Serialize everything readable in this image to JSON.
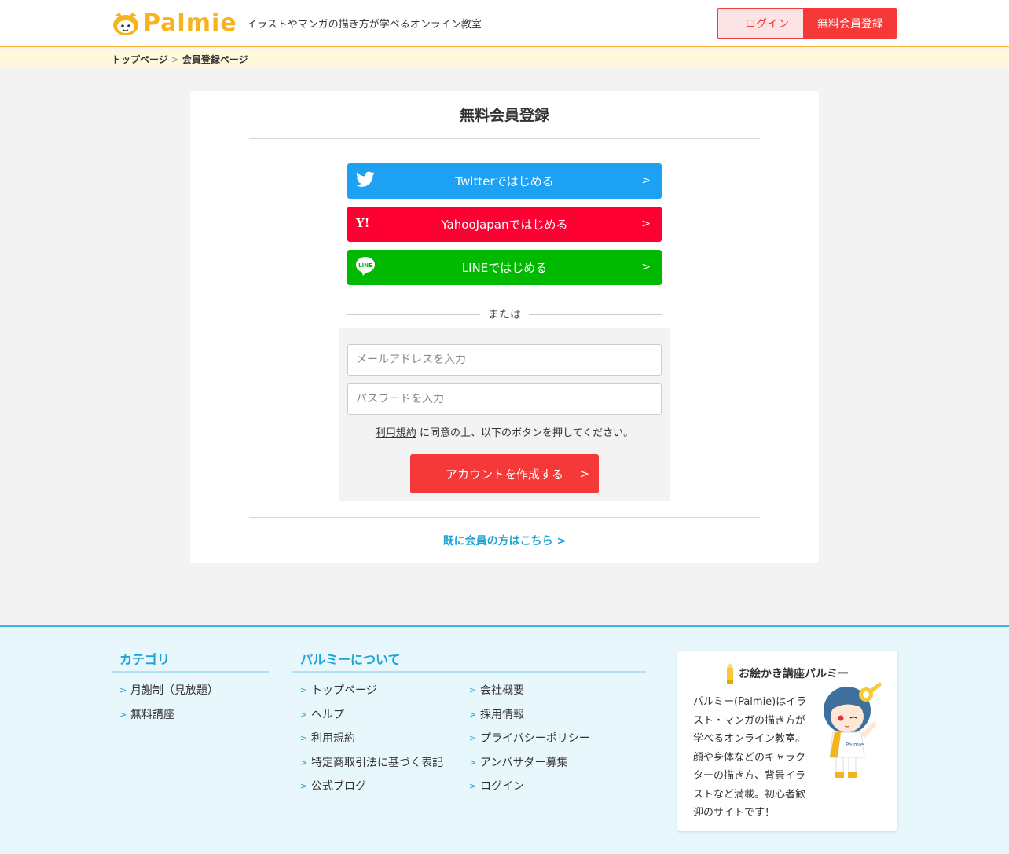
{
  "header": {
    "logo_text": "Palmie",
    "tagline": "イラストやマンガの描き方が学べるオンライン教室",
    "login_label": "ログイン",
    "signup_label": "無料会員登録"
  },
  "breadcrumb": {
    "items": [
      "トップページ",
      "会員登録ページ"
    ],
    "separator": ">"
  },
  "register": {
    "title": "無料会員登録",
    "twitter_label": "Twitterではじめる",
    "yahoo_label": "YahooJapanではじめる",
    "line_label": "LINEではじめる",
    "or_label": "または",
    "email_placeholder": "メールアドレスを入力",
    "password_placeholder": "パスワードを入力",
    "terms_link": "利用規約",
    "agree_text": " に同意の上、以下のボタンを押してください。",
    "create_label": "アカウントを作成する",
    "member_link": "既に会員の方はこちら >",
    "chevron": ">"
  },
  "footer": {
    "category": {
      "heading": "カテゴリ",
      "items": [
        "月謝制（見放題）",
        "無料講座"
      ]
    },
    "about": {
      "heading": "パルミーについて",
      "col1": [
        "トップページ",
        "ヘルプ",
        "利用規約",
        "特定商取引法に基づく表記",
        "公式ブログ"
      ],
      "col2": [
        "会社概要",
        "採用情報",
        "プライバシーポリシー",
        "アンバサダー募集",
        "ログイン"
      ]
    },
    "promo": {
      "title": "お絵かき講座パルミー",
      "text": "パルミー(Palmie)はイラスト・マンガの描き方が学べるオンライン教室。顔や身体などのキャラクターの描き方、背景イラストなど満載。初心者歓迎のサイトです！"
    },
    "arrow": ">"
  },
  "colors": {
    "brand_yellow": "#f5b41e",
    "brand_red": "#f53838",
    "twitter": "#1da1f2",
    "yahoo": "#ff0033",
    "line": "#00b900",
    "link_blue": "#1fa3d6"
  },
  "icons": {
    "twitter": "twitter-bird-icon",
    "yahoo": "yahoo-y-icon",
    "line": "line-bubble-icon"
  }
}
